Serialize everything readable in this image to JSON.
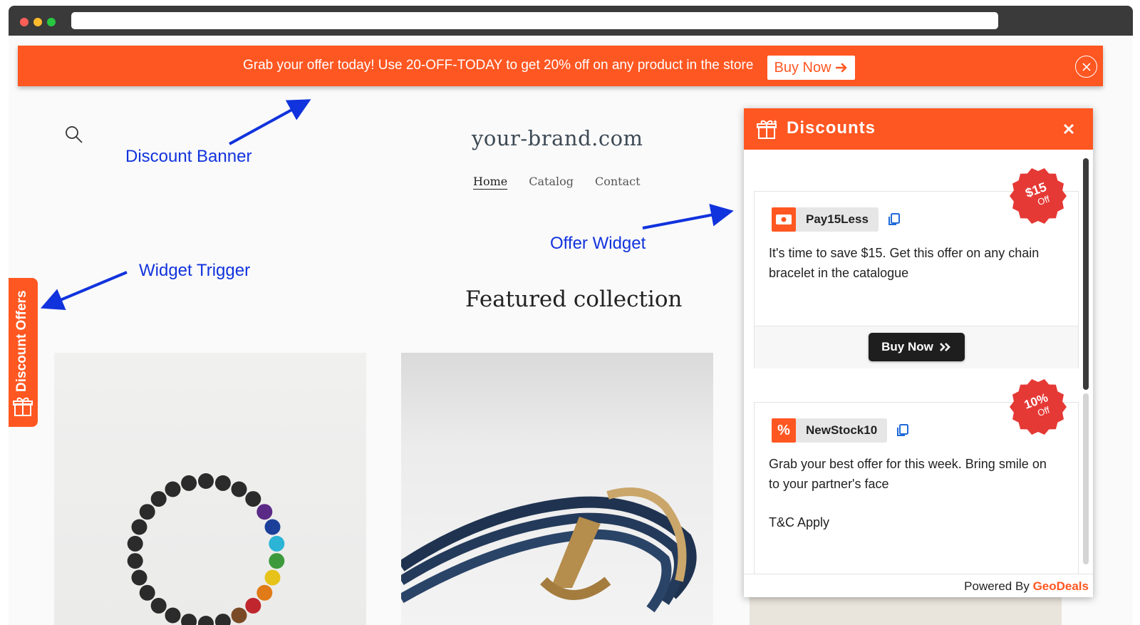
{
  "banner": {
    "message": "Grab your offer today! Use 20-OFF-TODAY to get 20% off on any product in the store",
    "button_label": "Buy Now",
    "button_icon": "arrow-right-icon",
    "close_icon": "close-icon"
  },
  "store": {
    "brand": "your-brand.com",
    "nav": [
      "Home",
      "Catalog",
      "Contact"
    ],
    "active_nav": "Home",
    "featured_title": "Featured collection"
  },
  "annotations": {
    "discount_banner": "Discount Banner",
    "offer_widget": "Offer Widget",
    "widget_trigger": "Widget Trigger"
  },
  "trigger": {
    "label": "Discount Offers",
    "icon": "gift-icon"
  },
  "widget": {
    "title": "Discounts",
    "icon": "gift-icon",
    "close_icon": "close-icon",
    "offers": [
      {
        "code": "Pay15Less",
        "icon": "cash-icon",
        "description": "It's time to save $15.  Get this offer on any chain bracelet in the catalogue",
        "button_label": "Buy Now",
        "badge_value": "$15",
        "badge_suffix": "Off"
      },
      {
        "code": "NewStock10",
        "icon": "percent-icon",
        "description": "Grab your best offer for this week. Bring smile on to your partner's face",
        "terms": "T&C Apply",
        "badge_value": "10%",
        "badge_suffix": "Off"
      }
    ],
    "powered_prefix": "Powered By",
    "powered_brand": "GeoDeals"
  },
  "colors": {
    "accent": "#ff5722",
    "annotation": "#1133dd",
    "badge": "#e53935"
  }
}
